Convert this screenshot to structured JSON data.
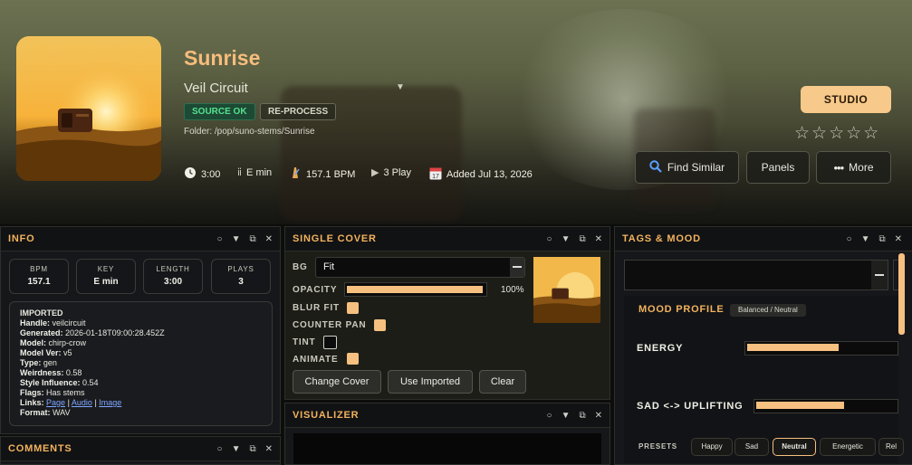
{
  "track": {
    "title": "Sunrise",
    "artist": "Veil Circuit",
    "badge_ok": "SOURCE OK",
    "badge_reprocess": "RE-PROCESS",
    "folder": "Folder: /pop/suno-stems/Sunrise",
    "duration": "3:00",
    "key": "E min",
    "bpm": "157.1 BPM",
    "plays": "3 Play",
    "added": "Added Jul 13, 2026",
    "rating": "☆☆☆☆☆"
  },
  "actions": {
    "studio": "STUDIO",
    "find_similar": "Find Similar",
    "panels": "Panels",
    "more": "More"
  },
  "info": {
    "title": "INFO",
    "stats": [
      {
        "label": "BPM",
        "value": "157.1"
      },
      {
        "label": "KEY",
        "value": "E min"
      },
      {
        "label": "LENGTH",
        "value": "3:00"
      },
      {
        "label": "PLAYS",
        "value": "3"
      }
    ],
    "imported_heading": "IMPORTED",
    "handle": "veilcircuit",
    "generated": "2026-01-18T09:00:28.452Z",
    "model": "chirp-crow",
    "model_ver": "v5",
    "type": "gen",
    "weirdness": "0.58",
    "style_influence": "0.54",
    "flags": "Has stems",
    "link_page": "Page",
    "link_audio": "Audio",
    "link_image": "Image",
    "format": "WAV",
    "labels": {
      "handle": "Handle:",
      "generated": "Generated:",
      "model": "Model:",
      "model_ver": "Model Ver:",
      "type": "Type:",
      "weirdness": "Weirdness:",
      "style_influence": "Style Influence:",
      "flags": "Flags:",
      "links": "Links:",
      "format": "Format:"
    }
  },
  "comments": {
    "title": "COMMENTS"
  },
  "single_cover": {
    "title": "SINGLE COVER",
    "bg_label": "BG",
    "bg_value": "Fit",
    "opacity_label": "OPACITY",
    "opacity_value": "100%",
    "opacity": 1.0,
    "blur_fit_label": "BLUR FIT",
    "counter_pan_label": "COUNTER PAN",
    "tint_label": "TINT",
    "animate_label": "ANIMATE",
    "change_cover": "Change Cover",
    "use_imported": "Use Imported",
    "clear": "Clear"
  },
  "visualizer": {
    "title": "VISUALIZER"
  },
  "tags_mood": {
    "title": "TAGS & MOOD",
    "mood_profile": "MOOD PROFILE",
    "mood_badge": "Balanced / Neutral",
    "energy_label": "ENERGY",
    "energy_level": 0.61,
    "sad_uplifting_label": "SAD <-> UPLIFTING",
    "sad_uplifting_level": 0.62,
    "presets_label": "PRESETS",
    "presets": [
      "Happy",
      "Sad",
      "Neutral",
      "Energetic",
      "Rel"
    ]
  },
  "colors": {
    "accent": "#f6c080",
    "title": "#f2b35e",
    "ok": "#56e08f"
  }
}
